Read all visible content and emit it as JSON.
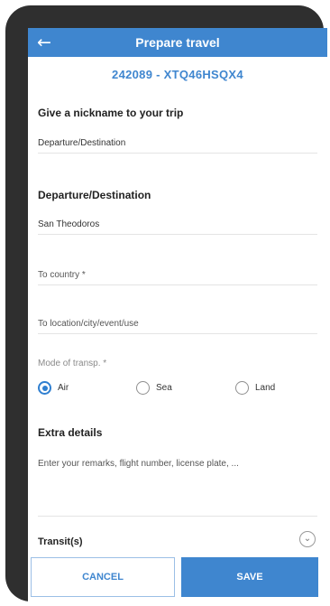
{
  "header": {
    "title": "Prepare travel",
    "back_icon": "arrow-left-icon"
  },
  "trip_code": "242089 - XTQ46HSQX4",
  "nickname": {
    "title": "Give a nickname to your trip",
    "value": "Departure/Destination"
  },
  "departure": {
    "title": "Departure/Destination",
    "from_value": "San Theodoros",
    "to_country_placeholder": "To country *",
    "to_location_placeholder": "To location/city/event/use"
  },
  "transport": {
    "label": "Mode of transp. *",
    "options": [
      "Air",
      "Sea",
      "Land"
    ],
    "selected": "Air"
  },
  "extra": {
    "title": "Extra details",
    "placeholder": "Enter your remarks, flight number, license plate, ..."
  },
  "transit": {
    "title": "Transit(s)"
  },
  "actions": {
    "cancel": "CANCEL",
    "save": "SAVE"
  },
  "colors": {
    "accent": "#3f86cf",
    "frame": "#2f2f2f"
  }
}
